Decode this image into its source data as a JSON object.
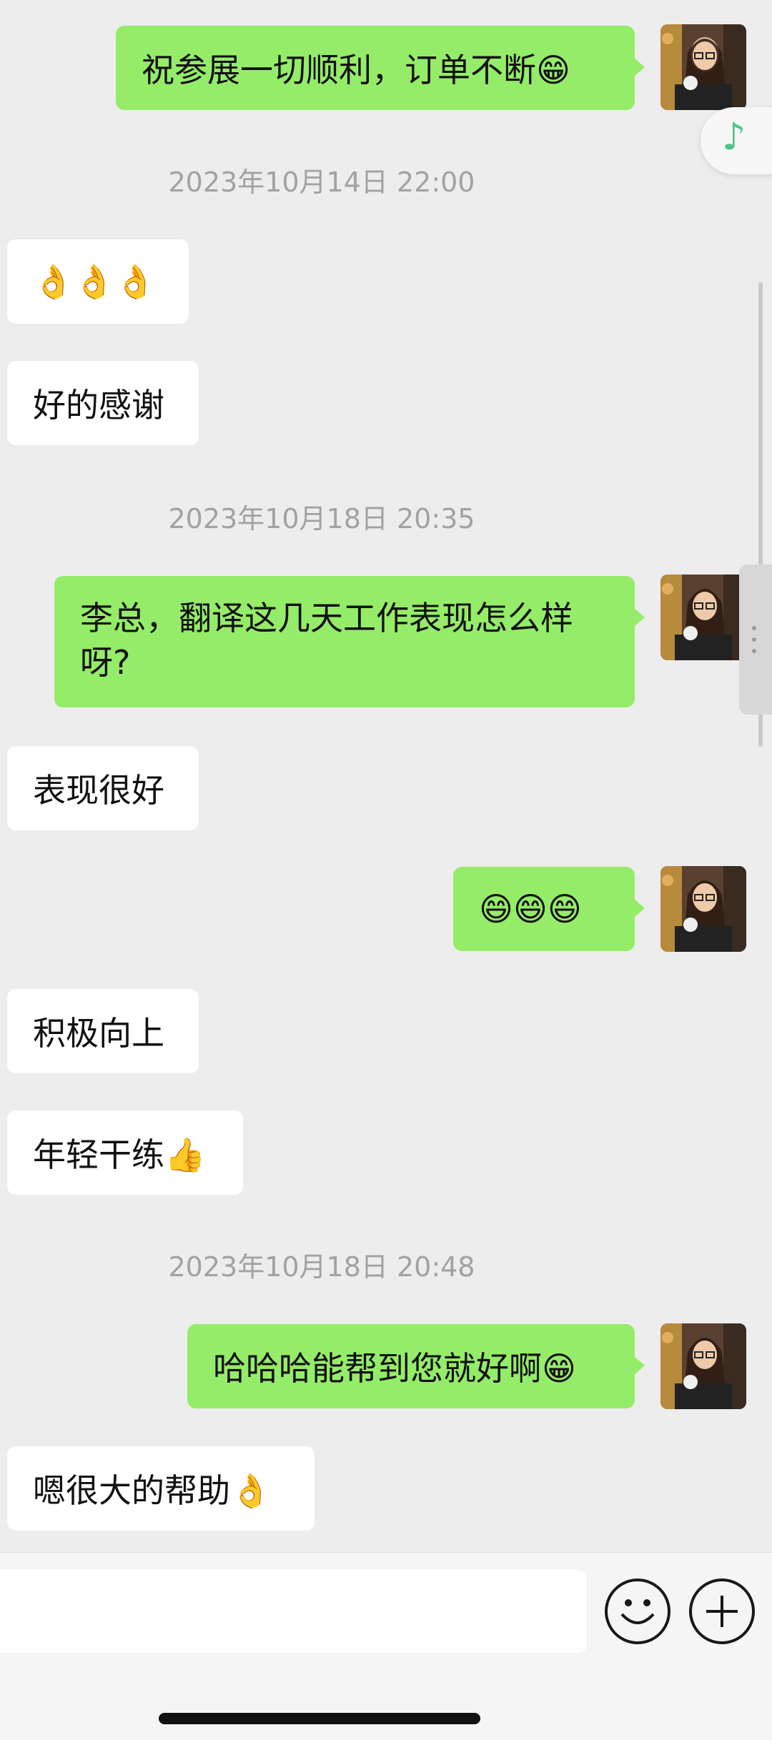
{
  "conversation": {
    "messages": [
      {
        "type": "out",
        "text": "祝参展一切顺利，订单不断😁"
      },
      {
        "type": "timestamp",
        "text": "2023年10月14日 22:00"
      },
      {
        "type": "in",
        "text": "👌👌👌"
      },
      {
        "type": "in",
        "text": "好的感谢"
      },
      {
        "type": "timestamp",
        "text": "2023年10月18日 20:35"
      },
      {
        "type": "out",
        "text": "李总，翻译这几天工作表现怎么样呀?"
      },
      {
        "type": "in",
        "text": "表现很好"
      },
      {
        "type": "out",
        "text": "😄😄😄"
      },
      {
        "type": "in",
        "text": "积极向上"
      },
      {
        "type": "in",
        "text": "年轻干练👍"
      },
      {
        "type": "timestamp",
        "text": "2023年10月18日 20:48"
      },
      {
        "type": "out",
        "text": "哈哈哈能帮到您就好啊😁"
      },
      {
        "type": "in",
        "text": "嗯很大的帮助👌"
      }
    ]
  },
  "floating_music": {
    "icon": "music-note-icon",
    "glyph": "♪",
    "color": "#4cc68a"
  },
  "input_bar": {
    "emoji_icon": "emoji-face-icon",
    "add_icon": "plus-circle-icon"
  },
  "colors": {
    "background": "#ededed",
    "outgoing_bubble": "#95ec69",
    "incoming_bubble": "#ffffff",
    "timestamp_text": "#a2a2a2"
  }
}
